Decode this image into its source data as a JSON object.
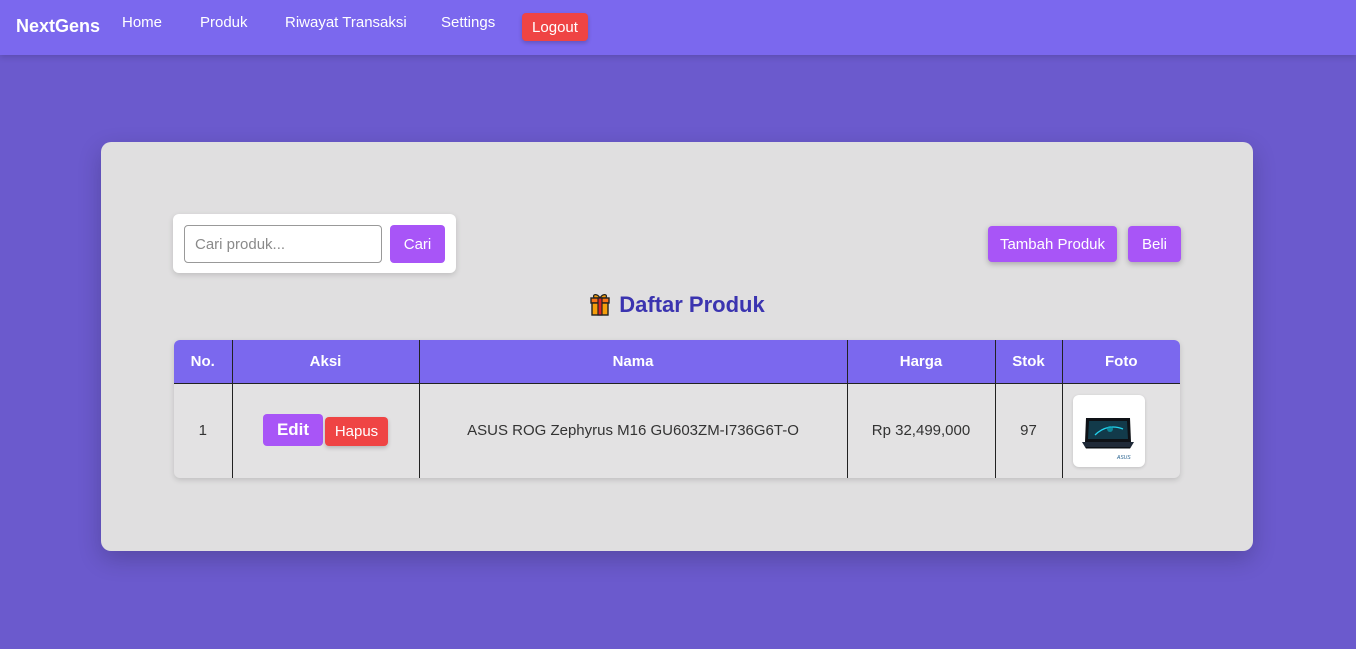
{
  "navbar": {
    "brand": "NextGens",
    "links": [
      "Home",
      "Produk",
      "Riwayat Transaksi",
      "Settings"
    ],
    "logout_label": "Logout",
    "color": "#7b68ee"
  },
  "search": {
    "placeholder": "Cari produk...",
    "value": "",
    "button_label": "Cari"
  },
  "actions": {
    "add_label": "Tambah Produk",
    "buy_label": "Beli"
  },
  "title": {
    "icon": "gift-icon",
    "text": "Daftar Produk"
  },
  "table": {
    "headers": [
      "No.",
      "Aksi",
      "Nama",
      "Harga",
      "Stok",
      "Foto"
    ],
    "rows": [
      {
        "no": "1",
        "edit_label": "Edit",
        "delete_label": "Hapus",
        "nama": "ASUS ROG Zephyrus M16 GU603ZM-I736G6T-O",
        "harga": "Rp 32,499,000",
        "stok": "97",
        "foto": "laptop-image",
        "foto_brand": "ASUS"
      }
    ]
  },
  "colors": {
    "background": "#6b5acd",
    "primary_button": "#a855f7",
    "danger_button": "#ef4444",
    "title": "#3b34b0"
  }
}
